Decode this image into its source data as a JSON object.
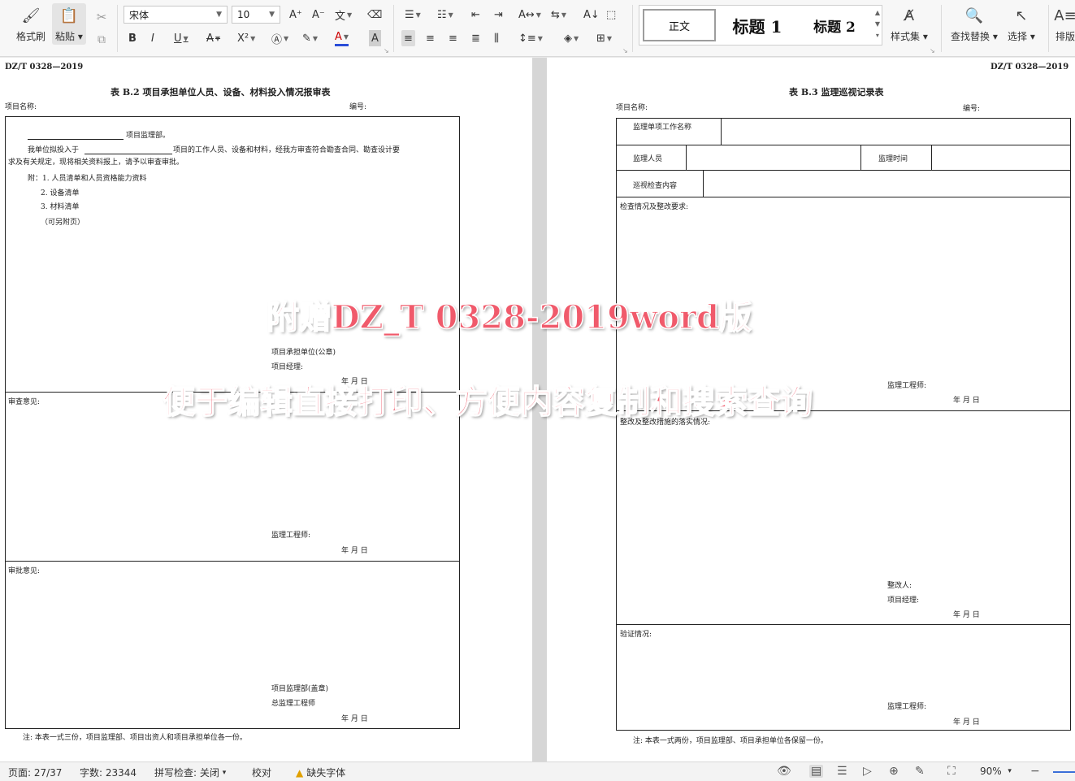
{
  "ribbon": {
    "format_painter": "格式刷",
    "paste": "粘贴",
    "font_name": "宋体",
    "font_size": "10",
    "bold": "B",
    "italic": "I",
    "underline": "U",
    "strike": "A",
    "superscript": "X²",
    "font_color": "A",
    "styles": {
      "normal": "正文",
      "heading1": "标题 1",
      "heading2": "标题 2"
    },
    "style_set": "样式集",
    "find_replace": "查找替换",
    "select": "选择",
    "sort": "排版"
  },
  "left_page": {
    "header": "DZ/T    0328—2019",
    "title": "表 B.2    项目承担单位人员、设备、材料投入情况报审表",
    "project_name": "项目名称:",
    "number": "编号:",
    "to_dept": "项目监理部。",
    "line1a": "我单位拟投入于",
    "line1b": "项目的工作人员、设备和材料，经我方审查符合勘查合同、勘查设计要",
    "line2": "求及有关规定，现将相关资料报上，请予以审查审批。",
    "attach1": "附：1. 人员清单和人员资格能力资料",
    "attach2": "2. 设备清单",
    "attach3": "3. 材料清单",
    "attach4": "（可另附页）",
    "unit_seal": "项目承担单位(公章)",
    "pm": "项目经理:",
    "date1": "年    月    日",
    "review_opinion": "审查意见:",
    "supervisor_engineer": "监理工程师:",
    "date2": "年    月    日",
    "approval_opinion": "审批意见:",
    "dept_seal": "项目监理部(盖章)",
    "chief_engineer": "总监理工程师",
    "date3": "年    月    日",
    "note": "注:  本表一式三份，项目监理部、项目出资人和项目承担单位各一份。"
  },
  "right_page": {
    "header": "DZ/T    0328—2019",
    "title": "表 B.3    监理巡视记录表",
    "project_name": "项目名称:",
    "number": "编号:",
    "item_name": "监理单项工作名称",
    "personnel": "监理人员",
    "time": "监理时间",
    "inspection_content": "巡视检查内容",
    "situation": "检查情况及整改要求:",
    "engineer1": "监理工程师:",
    "date1": "年    月    日",
    "rectification": "整改及整改措施的落实情况:",
    "rectifier": "整改人:",
    "pm": "项目经理:",
    "date2": "年    月    日",
    "verification": "验证情况:",
    "engineer2": "监理工程师:",
    "date3": "年    月    日",
    "note": "注:  本表一式两份，项目监理部、项目承担单位各保留一份。"
  },
  "watermark": {
    "line1": "附赠DZ_T  0328-2019word版",
    "line2": "便于编辑直接打印、方便内容复制和搜索查询",
    "color": "#f05a6b"
  },
  "status": {
    "page": "页面: 27/37",
    "words": "字数: 23344",
    "spell": "拼写检查: 关闭",
    "proof": "校对",
    "missing_font": "缺失字体",
    "zoom": "90%"
  }
}
